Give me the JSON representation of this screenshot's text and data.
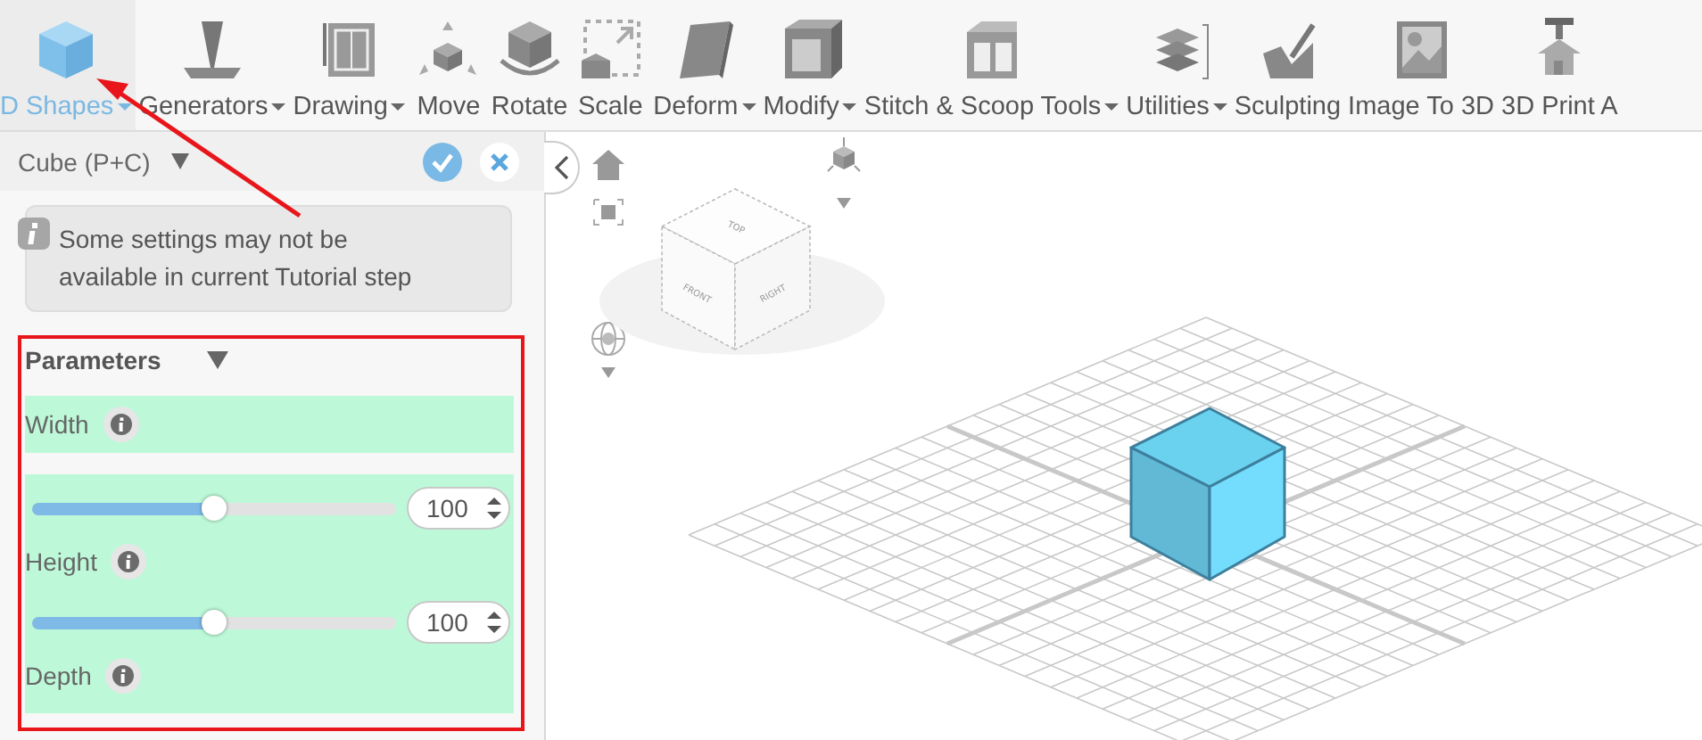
{
  "toolbar": {
    "items": [
      {
        "label": "D Shapes",
        "dropdown": true,
        "selected": true
      },
      {
        "label": "Generators",
        "dropdown": true,
        "selected": false
      },
      {
        "label": "Drawing",
        "dropdown": true,
        "selected": false
      },
      {
        "label": "Move",
        "dropdown": false,
        "selected": false
      },
      {
        "label": "Rotate",
        "dropdown": false,
        "selected": false
      },
      {
        "label": "Scale",
        "dropdown": false,
        "selected": false
      },
      {
        "label": "Deform",
        "dropdown": true,
        "selected": false
      },
      {
        "label": "Modify",
        "dropdown": true,
        "selected": false
      },
      {
        "label": "Stitch & Scoop Tools",
        "dropdown": true,
        "selected": false
      },
      {
        "label": "Utilities",
        "dropdown": true,
        "selected": false
      },
      {
        "label": "Sculpting",
        "dropdown": false,
        "selected": false
      },
      {
        "label": "Image To 3D",
        "dropdown": false,
        "selected": false
      },
      {
        "label": "3D Print A",
        "dropdown": false,
        "selected": false
      }
    ]
  },
  "panel": {
    "title": "Cube (P+C)",
    "notice": "Some settings may not be available in current Tutorial step",
    "section": {
      "title": "Parameters",
      "expanded": true,
      "params": [
        {
          "label": "Width",
          "value": "100",
          "level": 0.5
        },
        {
          "label": "Height",
          "value": "100",
          "level": 0.5
        },
        {
          "label": "Depth"
        }
      ]
    }
  },
  "viewport": {
    "nav_cube": {
      "faces": [
        "TOP",
        "FRONT",
        "RIGHT"
      ]
    }
  }
}
